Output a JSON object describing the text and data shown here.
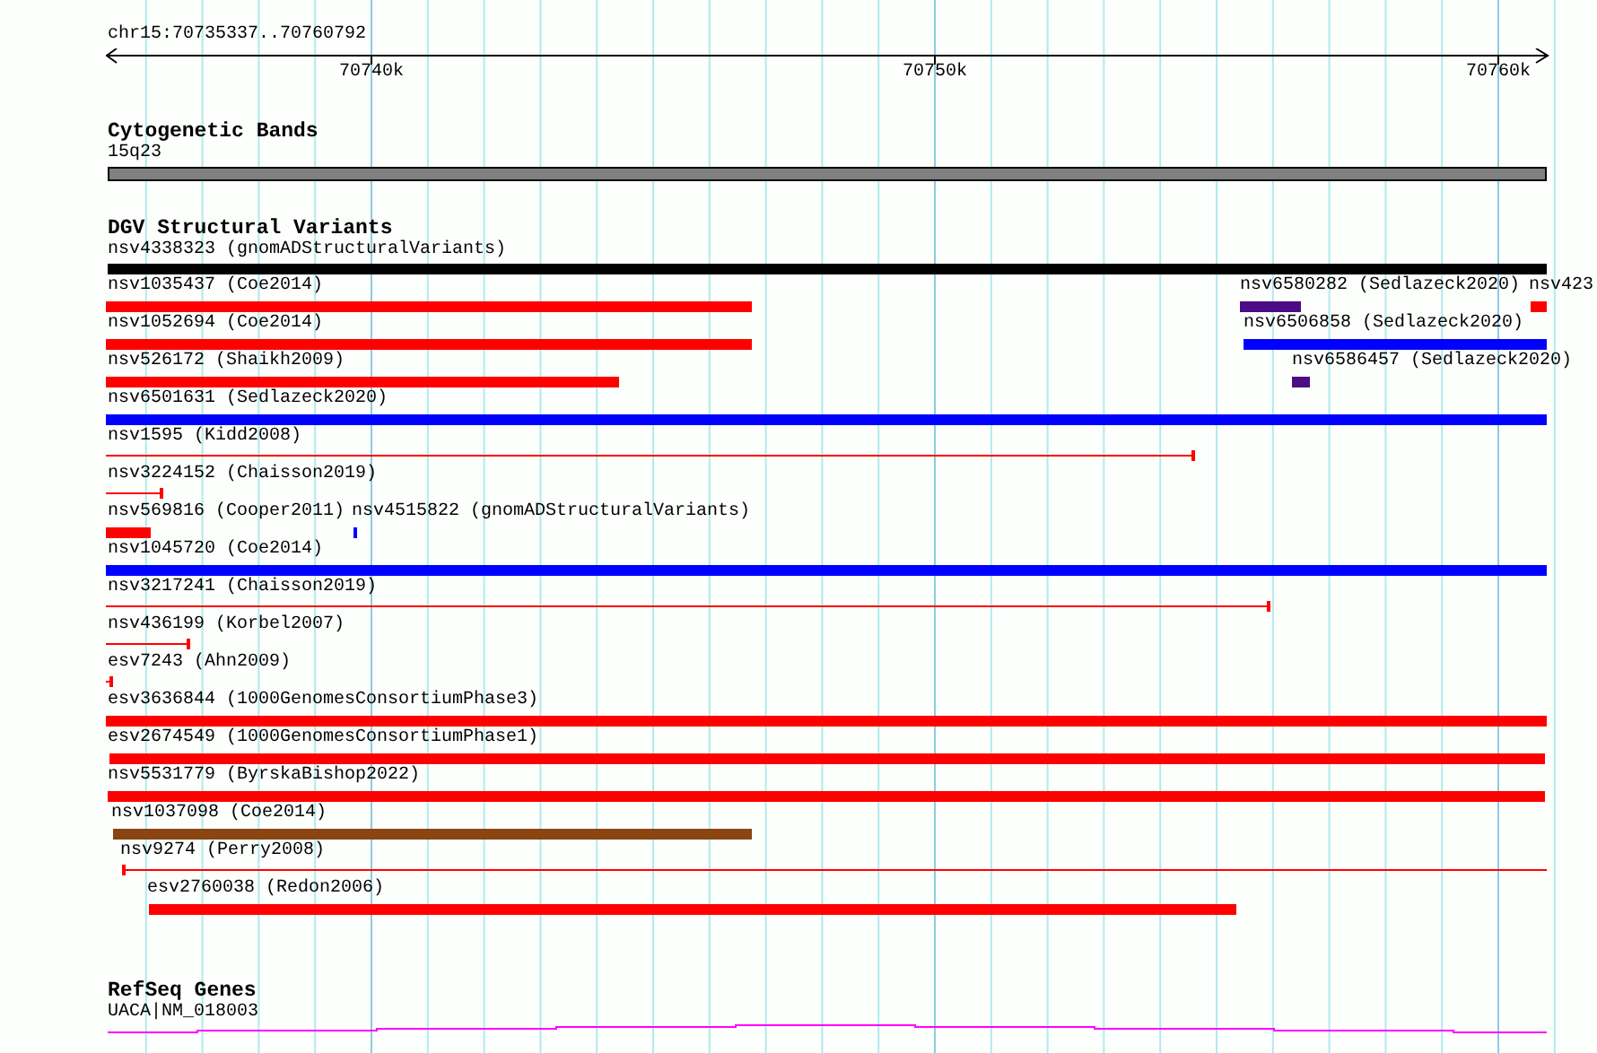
{
  "ruler": {
    "location": "chr15:70735337..70760792",
    "ticks": [
      "70740k",
      "70750k",
      "70760k"
    ]
  },
  "tracks": [
    {
      "title": "Cytogenetic Bands",
      "features": [
        {
          "label": "15q23",
          "kind": "band",
          "color": "#808080"
        }
      ]
    },
    {
      "title": "DGV Structural Variants",
      "features": [
        {
          "label": "nsv4338323 (gnomADStructuralVariants)",
          "kind": "bar",
          "color": "#000000"
        },
        {
          "label": "nsv1035437 (Coe2014)",
          "kind": "bar",
          "color": "#ff0000"
        },
        {
          "label": "nsv6580282 (Sedlazeck2020)",
          "kind": "bar",
          "color": "#4b0c85"
        },
        {
          "label": "nsv423",
          "kind": "bar",
          "color": "#ff0000"
        },
        {
          "label": "nsv1052694 (Coe2014)",
          "kind": "bar",
          "color": "#ff0000"
        },
        {
          "label": "nsv6506858 (Sedlazeck2020)",
          "kind": "bar",
          "color": "#0000ff"
        },
        {
          "label": "nsv526172 (Shaikh2009)",
          "kind": "bar",
          "color": "#ff0000"
        },
        {
          "label": "nsv6586457 (Sedlazeck2020)",
          "kind": "bar",
          "color": "#4b0c85"
        },
        {
          "label": "nsv6501631 (Sedlazeck2020)",
          "kind": "bar",
          "color": "#0000ff"
        },
        {
          "label": "nsv1595 (Kidd2008)",
          "kind": "line",
          "color": "#ff0000"
        },
        {
          "label": "nsv3224152 (Chaisson2019)",
          "kind": "line",
          "color": "#ff0000"
        },
        {
          "label": "nsv569816 (Cooper2011)",
          "kind": "bar",
          "color": "#ff0000"
        },
        {
          "label": "nsv4515822 (gnomADStructuralVariants)",
          "kind": "bar",
          "color": "#0000ff"
        },
        {
          "label": "nsv1045720 (Coe2014)",
          "kind": "bar",
          "color": "#0000ff"
        },
        {
          "label": "nsv3217241 (Chaisson2019)",
          "kind": "line",
          "color": "#ff0000"
        },
        {
          "label": "nsv436199 (Korbel2007)",
          "kind": "line",
          "color": "#ff0000"
        },
        {
          "label": "esv7243 (Ahn2009)",
          "kind": "line",
          "color": "#ff0000"
        },
        {
          "label": "esv3636844 (1000GenomesConsortiumPhase3)",
          "kind": "bar",
          "color": "#ff0000"
        },
        {
          "label": "esv2674549 (1000GenomesConsortiumPhase1)",
          "kind": "bar",
          "color": "#ff0000"
        },
        {
          "label": "nsv5531779 (ByrskaBishop2022)",
          "kind": "bar",
          "color": "#ff0000"
        },
        {
          "label": "nsv1037098 (Coe2014)",
          "kind": "bar",
          "color": "#8b4513"
        },
        {
          "label": "nsv9274 (Perry2008)",
          "kind": "line",
          "color": "#ff0000"
        },
        {
          "label": "esv2760038 (Redon2006)",
          "kind": "bar",
          "color": "#ff0000"
        }
      ]
    },
    {
      "title": "RefSeq Genes",
      "features": [
        {
          "label": "UACA|NM_018003",
          "kind": "gene",
          "color": "#ff00ff"
        }
      ]
    }
  ]
}
